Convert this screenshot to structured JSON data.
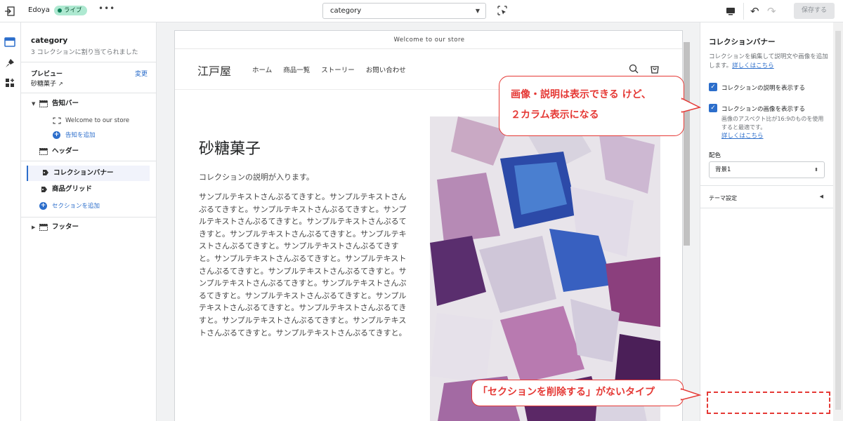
{
  "topbar": {
    "store_name": "Edoya",
    "status_badge": "ライブ",
    "more_label": "•••",
    "template_select": "category",
    "save_label": "保存する"
  },
  "sidebar": {
    "title": "category",
    "subtitle": "3 コレクションに割り当てられました",
    "preview_label": "プレビュー",
    "change_label": "変更",
    "preview_value": "砂糖菓子",
    "tree": {
      "announcement_bar": "告知バー",
      "welcome_item": "Welcome to our store",
      "add_announcement": "告知を追加",
      "header": "ヘッダー",
      "collection_banner": "コレクションバナー",
      "product_grid": "商品グリッド",
      "add_section": "セクションを追加",
      "footer": "フッター"
    }
  },
  "preview": {
    "announcement": "Welcome to our store",
    "logo": "江戸屋",
    "nav": [
      "ホーム",
      "商品一覧",
      "ストーリー",
      "お問い合わせ"
    ],
    "collection_title": "砂糖菓子",
    "collection_description": "コレクションの説明が入ります。",
    "body_text": "サンプルテキストさんぷるてきすと。サンプルテキストさんぷるてきすと。サンプルテキストさんぷるてきすと。サンプルテキストさんぷるてきすと。サンプルテキストさんぷるてきすと。サンプルテキストさんぷるてきすと。サンプルテキストさんぷるてきすと。サンプルテキストさんぷるてきすと。サンプルテキストさんぷるてきすと。サンプルテキストさんぷるてきすと。サンプルテキストさんぷるてきすと。サンプルテキストさんぷるてきすと。サンプルテキストさんぷるてきすと。サンプルテキストさんぷるてきすと。サンプルテキストさんぷるてきすと。サンプルテキストさんぷるてきすと。サンプルテキストさんぷるてきすと。サンプルテキストさんぷるてきすと。サンプルテキストさんぷるてきすと。"
  },
  "right_panel": {
    "title": "コレクションバナー",
    "help_text": "コレクションを編集して説明文や画像を追加します。",
    "help_link": "詳しくはこちら",
    "show_description_label": "コレクションの説明を表示する",
    "show_image_label": "コレクションの画像を表示する",
    "image_help": "画像のアスペクト比が16:9のものを使用すると最適です。",
    "image_help_link": "詳しくはこちら",
    "color_label": "配色",
    "color_value": "背景1",
    "theme_settings": "テーマ設定"
  },
  "annotations": {
    "callout1_line1": "画像・説明は表示できる けど、",
    "callout1_line2": "２カラム表示になる",
    "callout2": "「セクションを削除する」がないタイプ"
  },
  "colors": {
    "accent": "#2c6ecb",
    "annotation": "#e53935",
    "live_badge": "#aee9d1"
  }
}
